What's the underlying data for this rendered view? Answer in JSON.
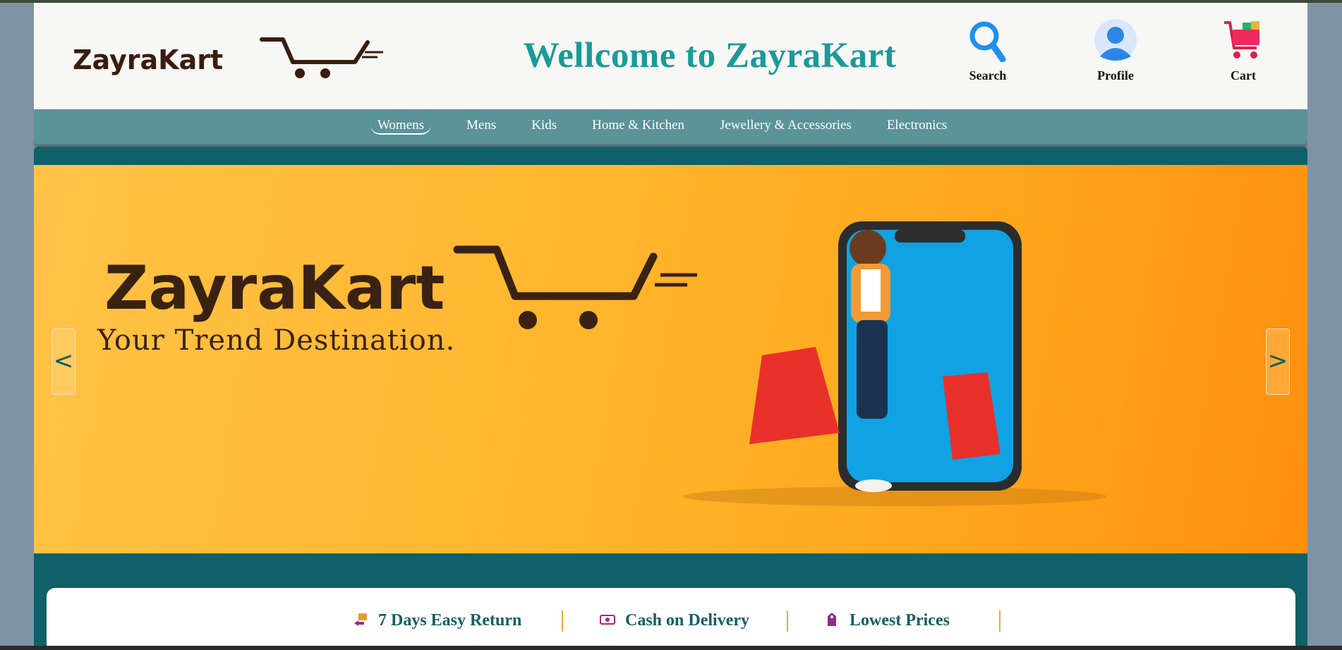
{
  "header": {
    "logo_text": "ZayraKart",
    "welcome": "Wellcome to ZayraKart",
    "actions": [
      {
        "label": "Search",
        "icon": "search-icon"
      },
      {
        "label": "Profile",
        "icon": "profile-icon"
      },
      {
        "label": "Cart",
        "icon": "cart-icon"
      }
    ]
  },
  "nav": {
    "items": [
      "Womens",
      "Mens",
      "Kids",
      "Home & Kitchen",
      "Jewellery & Accessories",
      "Electronics"
    ],
    "active": "Womens"
  },
  "banner": {
    "brand": "ZayraKart",
    "tagline": "Your Trend Destination.",
    "prev": "<",
    "next": ">"
  },
  "features": [
    {
      "label": "7 Days Easy Return",
      "icon": "return-icon"
    },
    {
      "label": "Cash on Delivery",
      "icon": "cash-icon"
    },
    {
      "label": "Lowest Prices",
      "icon": "price-tag-icon"
    }
  ],
  "colors": {
    "accent": "#1a9a99",
    "nav": "#5a9398",
    "teal_section": "#0f6068",
    "separator": "#f1a92a"
  }
}
